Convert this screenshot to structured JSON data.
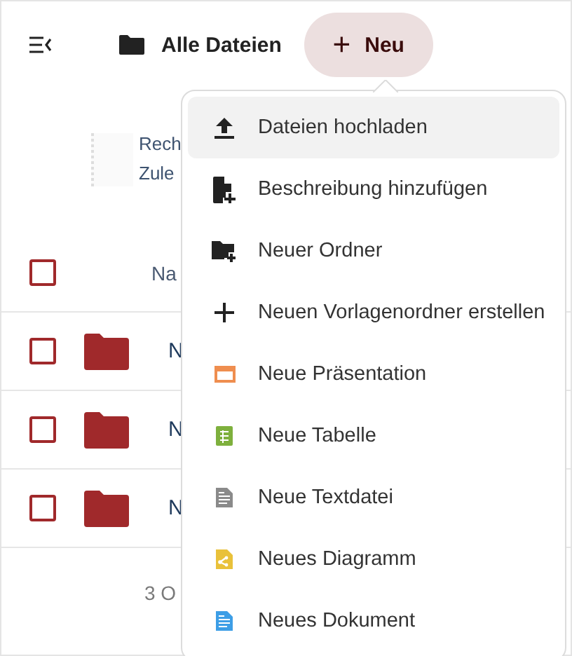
{
  "toolbar": {
    "breadcrumb": "Alle Dateien",
    "new_button": "Neu",
    "new_button_icon": "+"
  },
  "description": {
    "title": "Rech",
    "subtitle": "Zule"
  },
  "table": {
    "header": {
      "checked": false,
      "name_column": "Na"
    },
    "rows": [
      {
        "checked": false,
        "name": "N"
      },
      {
        "checked": false,
        "name": "N"
      },
      {
        "checked": false,
        "name": "N"
      }
    ],
    "footer": "3 O"
  },
  "menu": {
    "items": [
      {
        "kind": "upload",
        "label": "Dateien hochladen",
        "selected": true
      },
      {
        "kind": "file-plus",
        "label": "Beschreibung hinzufügen",
        "selected": false
      },
      {
        "kind": "folder-plus",
        "label": "Neuer Ordner",
        "selected": false
      },
      {
        "kind": "plus",
        "label": "Neuen Vorlagenordner erstellen",
        "selected": false
      },
      {
        "kind": "presentation",
        "label": "Neue Präsentation",
        "selected": false
      },
      {
        "kind": "spreadsheet",
        "label": "Neue Tabelle",
        "selected": false
      },
      {
        "kind": "text",
        "label": "Neue Textdatei",
        "selected": false
      },
      {
        "kind": "diagram",
        "label": "Neues Diagramm",
        "selected": false
      },
      {
        "kind": "document",
        "label": "Neues Dokument",
        "selected": false
      }
    ]
  }
}
